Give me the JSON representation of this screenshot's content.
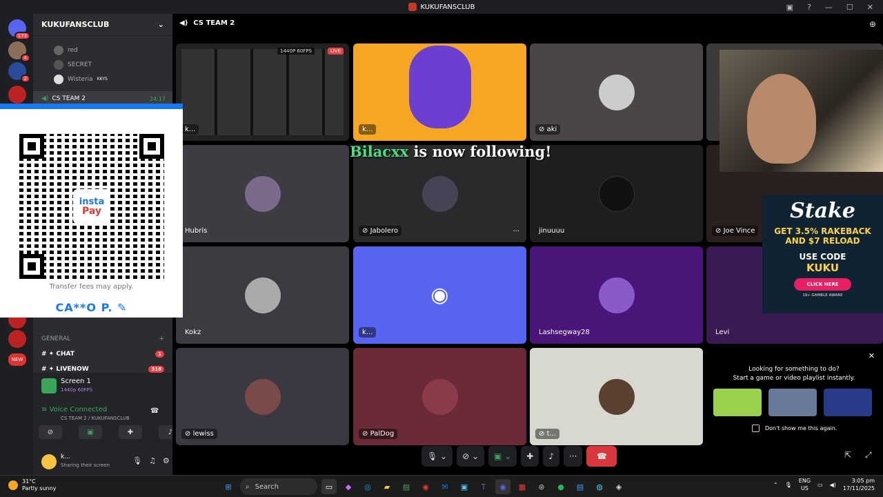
{
  "window": {
    "title": "KUKUFANSCLUB"
  },
  "servers": {
    "badges": [
      "173",
      "4",
      "2"
    ],
    "new_label": "NEW"
  },
  "channels": {
    "server_name": "KUKUFANSCLUB",
    "voice_users": [
      {
        "name": "red"
      },
      {
        "name": "SECRET"
      },
      {
        "name": "Wisteria",
        "tag": "KKYS"
      }
    ],
    "current_voice": {
      "name": "CS TEAM 2",
      "timer": "24:17"
    },
    "category": "GENERAL",
    "text_channels": [
      {
        "name": "CHAT",
        "badge": "1"
      },
      {
        "name": "LIVENOW",
        "badge": "318"
      }
    ]
  },
  "qr_card": {
    "logo_top": "insta",
    "logo_bottom": "Pay",
    "note": "Transfer fees may apply.",
    "name": "CA**O P."
  },
  "screen_panel": {
    "title": "Screen 1",
    "quality": "1440p 60FPS"
  },
  "voice_panel": {
    "status": "Voice Connected",
    "location": "CS TEAM 2 / KUKUFANSCLUB"
  },
  "user_panel": {
    "name": "k...",
    "status": "Sharing their screen"
  },
  "stage": {
    "channel_title": "CS TEAM 2",
    "stream_badge": "1440P 60FPS",
    "live_label": "LIVE",
    "tiles": [
      {
        "name": "k..."
      },
      {
        "name": "k..."
      },
      {
        "name": "aki"
      },
      {
        "name": "Hubris"
      },
      {
        "name": "Jabolero"
      },
      {
        "name": "jinuuuu"
      },
      {
        "name": "Joe Vince"
      },
      {
        "name": "Kokz"
      },
      {
        "name": "k..."
      },
      {
        "name": "Lashsegway28"
      },
      {
        "name": "Levi"
      },
      {
        "name": "lewiss"
      },
      {
        "name": "PalDog"
      },
      {
        "name": "t..."
      }
    ]
  },
  "follow_alert": {
    "user": "Bilacxx",
    "text": "is now following!"
  },
  "stake_ad": {
    "brand": "Stake",
    "line1": "GET 3.5% RAKEBACK",
    "line2": "AND $7 RELOAD",
    "code_label": "USE CODE",
    "code": "KUKU",
    "button": "CLICK HERE",
    "footer": "18+ GAMBLE AWARE"
  },
  "suggestion": {
    "line1": "Looking for something to do?",
    "line2": "Start a game or video playlist instantly.",
    "dont_show": "Don't show me this again."
  },
  "taskbar": {
    "temp": "31°C",
    "weather": "Partly sunny",
    "search_placeholder": "Search",
    "lang1": "ENG",
    "lang2": "US",
    "time": "3:05 pm",
    "date": "17/11/2025"
  }
}
